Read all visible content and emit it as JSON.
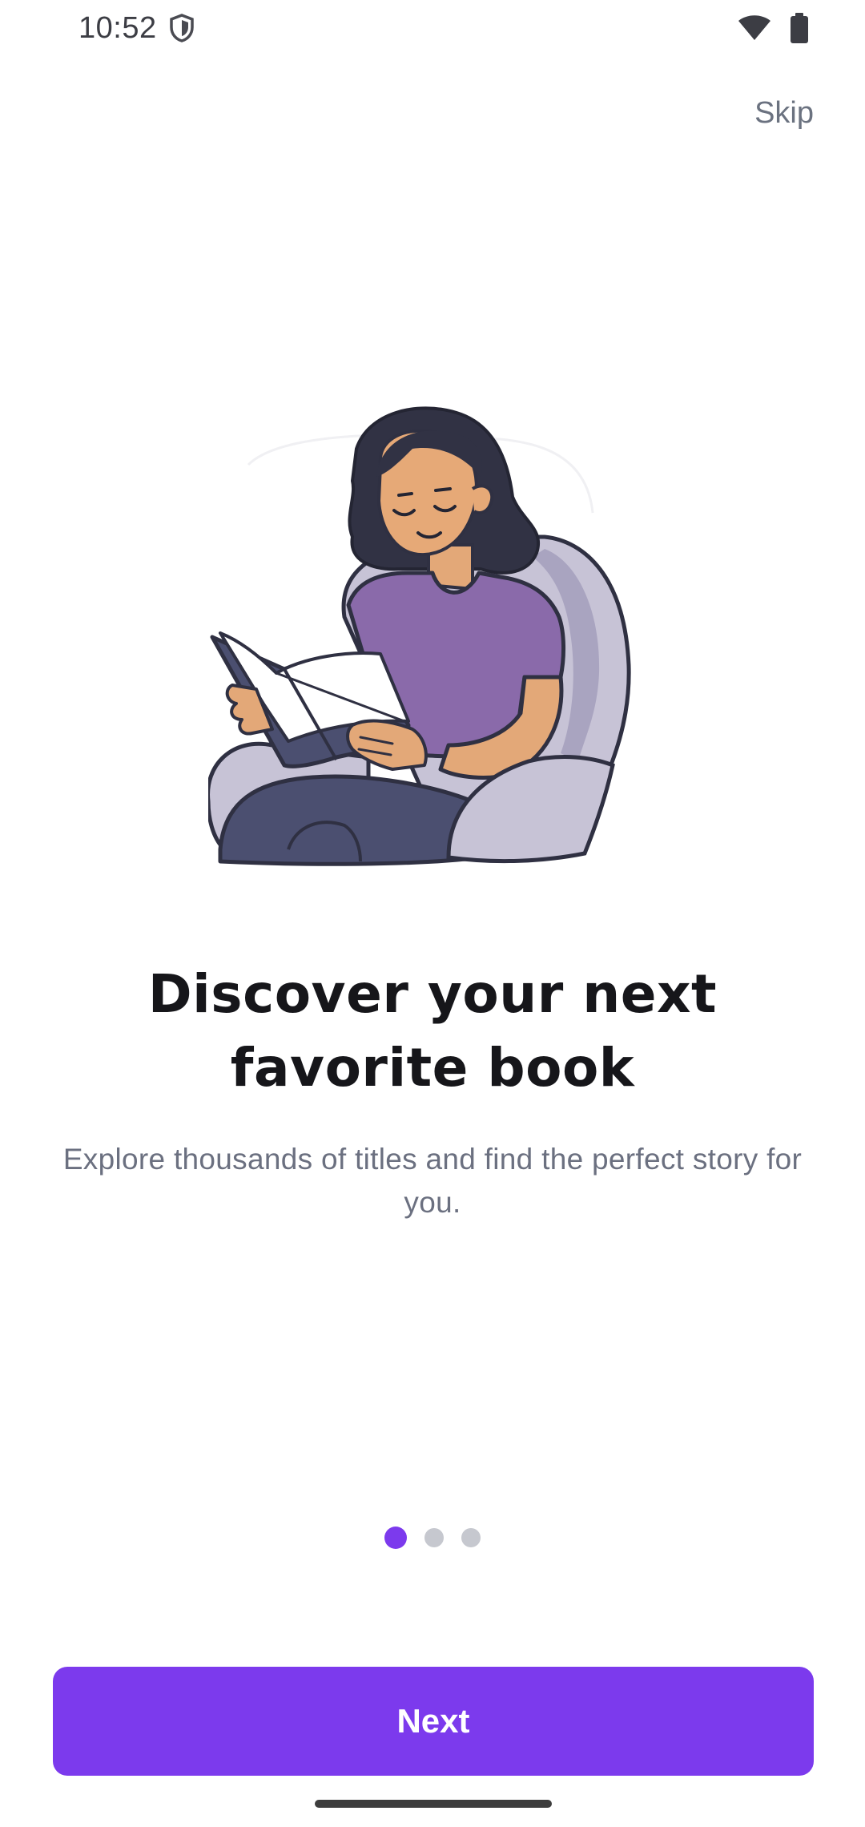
{
  "status_bar": {
    "time": "10:52",
    "icons": [
      "shield-icon",
      "wifi-icon",
      "battery-icon"
    ]
  },
  "onboarding": {
    "skip_label": "Skip",
    "headline": "Discover your next favorite book",
    "subtitle": "Explore thousands of titles and find the perfect story for you.",
    "page_count": 3,
    "current_page": 1,
    "next_label": "Next"
  },
  "colors": {
    "accent": "#7c3aed",
    "dot_inactive": "#c6c8cf",
    "headline": "#16161a",
    "subtitle": "#6b7080"
  }
}
